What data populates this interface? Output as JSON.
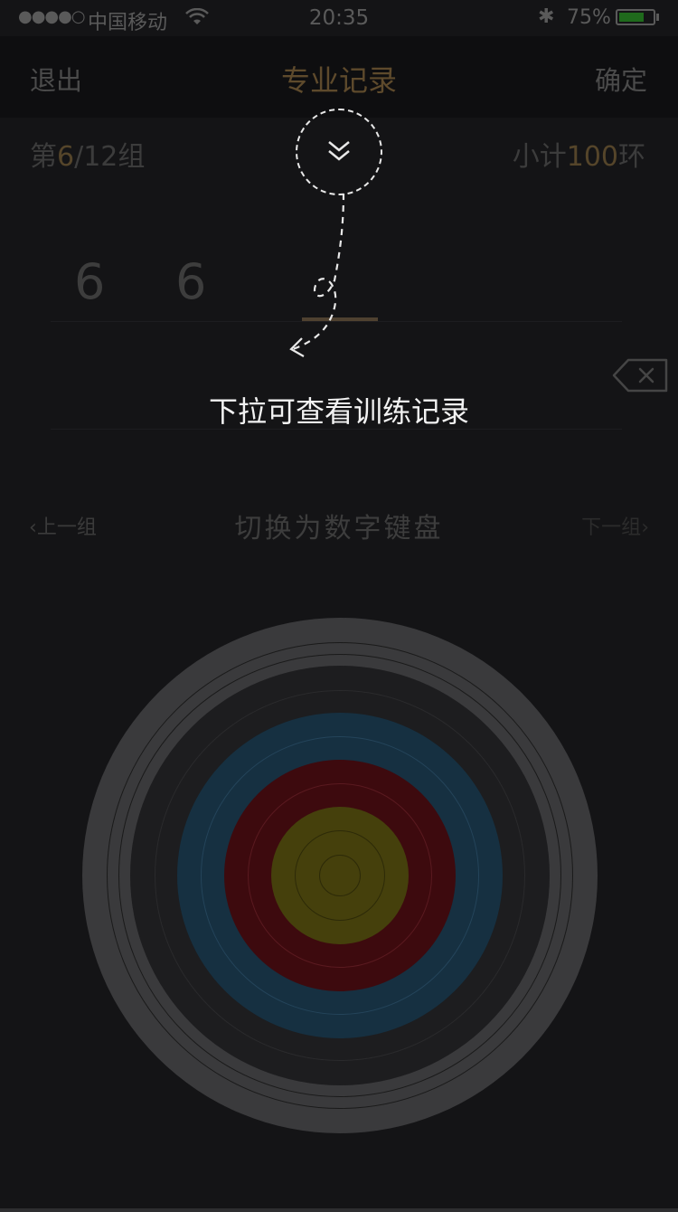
{
  "status_bar": {
    "signal": "●●●●○",
    "carrier": "中国移动",
    "time": "20:35",
    "bluetooth": "✱",
    "battery_percent": "75%",
    "battery_level": 0.75,
    "battery_color": "#1f6a1c"
  },
  "nav": {
    "left_label": "退出",
    "title": "专业记录",
    "right_label": "确定"
  },
  "group": {
    "prefix": "第",
    "current": "6",
    "total": "/12组",
    "subtotal_prefix": "小计",
    "subtotal_value": "100",
    "subtotal_unit": "环"
  },
  "scores": [
    "6",
    "6"
  ],
  "hint": {
    "text": "下拉可查看训练记录",
    "icon": "double-chevron-down-icon"
  },
  "group_nav": {
    "prev_label": "上一组",
    "next_label": "下一组",
    "switch_label": "切换为数字键盘"
  },
  "colors": {
    "accent": "#5e4a2c",
    "target_outer": "#3a3a3c",
    "target_black": "#1d1d1f",
    "target_blue": "#163041",
    "target_red": "#3d0a0e",
    "target_gold": "#45400c"
  }
}
